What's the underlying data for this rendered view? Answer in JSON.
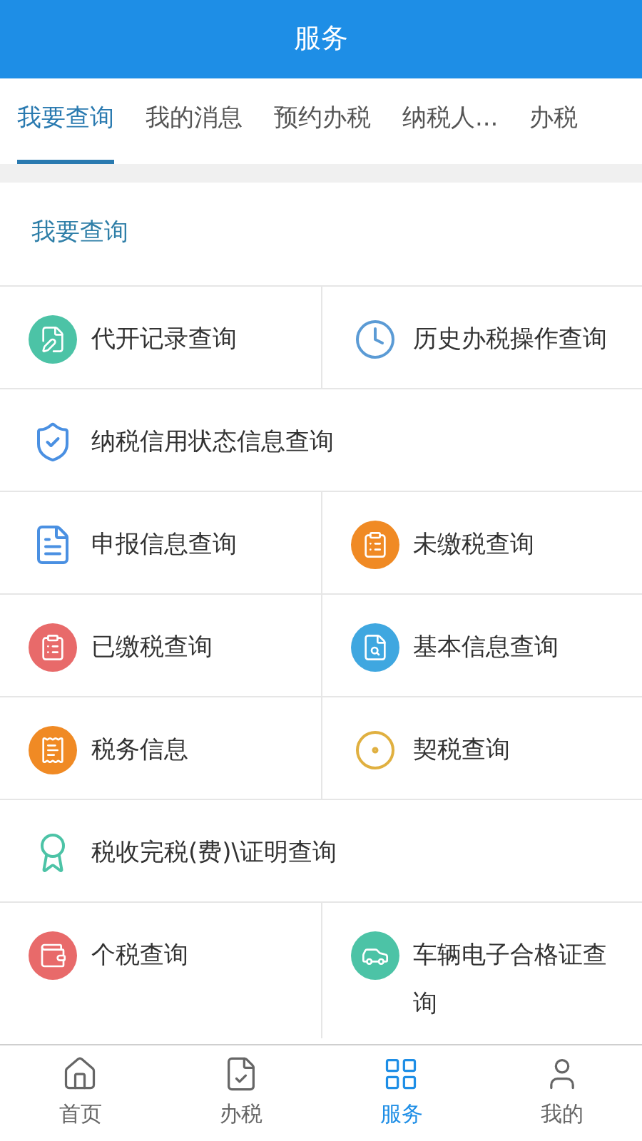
{
  "header": {
    "title": "服务"
  },
  "tabs": [
    {
      "label": "我要查询",
      "selected": true
    },
    {
      "label": "我的消息",
      "selected": false
    },
    {
      "label": "预约办税",
      "selected": false
    },
    {
      "label": "纳税人...",
      "selected": false
    },
    {
      "label": "办税",
      "selected": false
    }
  ],
  "section": {
    "title": "我要查询"
  },
  "rows": [
    {
      "items": [
        {
          "label": "代开记录查询"
        },
        {
          "label": "历史办税操作查询"
        }
      ]
    },
    {
      "items": [
        {
          "label": "纳税信用状态信息查询"
        }
      ]
    },
    {
      "items": [
        {
          "label": "申报信息查询"
        },
        {
          "label": "未缴税查询"
        }
      ]
    },
    {
      "items": [
        {
          "label": "已缴税查询"
        },
        {
          "label": "基本信息查询"
        }
      ]
    },
    {
      "items": [
        {
          "label": "税务信息"
        },
        {
          "label": "契税查询"
        }
      ]
    },
    {
      "items": [
        {
          "label": "税收完税(费)\\证明查询"
        }
      ]
    },
    {
      "items": [
        {
          "label": "个税查询"
        },
        {
          "label": "车辆电子合格证查询"
        }
      ]
    }
  ],
  "bottom_nav": [
    {
      "label": "首页",
      "selected": false
    },
    {
      "label": "办税",
      "selected": false
    },
    {
      "label": "服务",
      "selected": true
    },
    {
      "label": "我的",
      "selected": false
    }
  ]
}
